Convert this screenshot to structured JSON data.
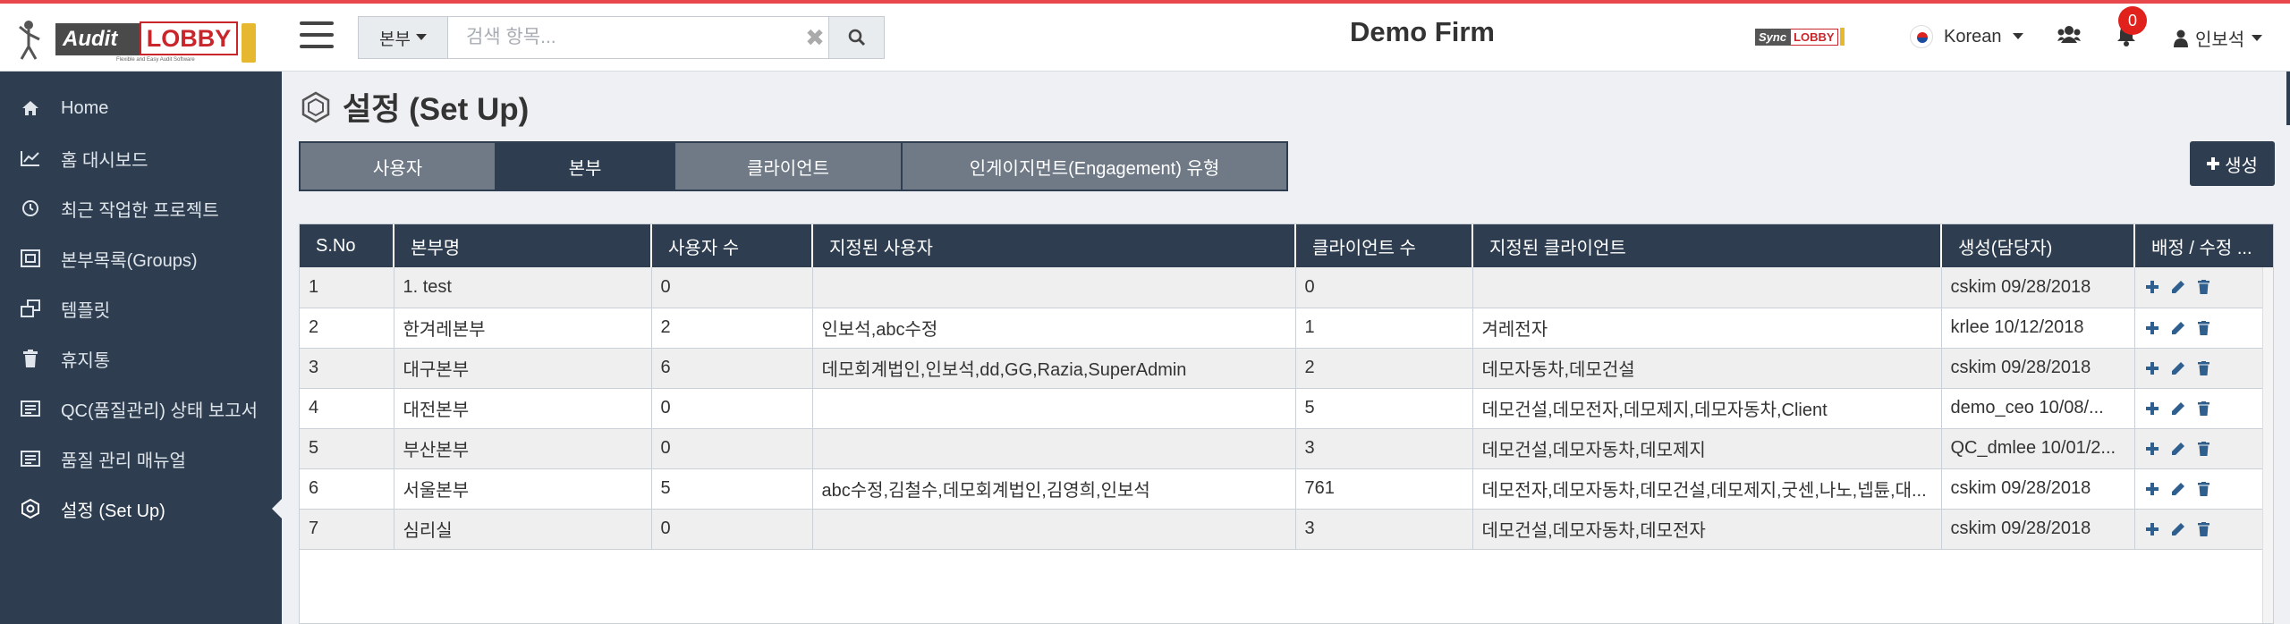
{
  "header": {
    "logo_audit": "Audit",
    "logo_lobby": "LOBBY",
    "logo_tagline": "Flexible and Easy Audit Software",
    "search_scope": "본부",
    "search_placeholder": "검색 항목...",
    "firm_name": "Demo Firm",
    "sync_logo_sync": "Sync",
    "sync_logo_lobby": "LOBBY",
    "language": "Korean",
    "notification_count": "0",
    "user_name": "인보석",
    "accent_color": "#e8474c"
  },
  "sidebar": {
    "items": [
      {
        "label": "Home",
        "icon": "home-icon"
      },
      {
        "label": "홈 대시보드",
        "icon": "chart-line-icon"
      },
      {
        "label": "최근 작업한 프로젝트",
        "icon": "clock-icon"
      },
      {
        "label": "본부목록(Groups)",
        "icon": "groups-icon"
      },
      {
        "label": "템플릿",
        "icon": "template-icon"
      },
      {
        "label": "휴지통",
        "icon": "trash-icon"
      },
      {
        "label": "QC(품질관리) 상태 보고서",
        "icon": "report-icon"
      },
      {
        "label": "품질 관리 매뉴얼",
        "icon": "manual-icon"
      },
      {
        "label": "설정 (Set Up)",
        "icon": "setup-icon"
      }
    ],
    "active_index": 8,
    "bg_color": "#2e3e50"
  },
  "page": {
    "title": "설정 (Set Up)",
    "tabs": [
      {
        "label": "사용자"
      },
      {
        "label": "본부"
      },
      {
        "label": "클라이언트"
      },
      {
        "label": "인게이지먼트(Engagement) 유형"
      }
    ],
    "active_tab": 1,
    "create_label": "생성"
  },
  "table": {
    "headers": [
      "S.No",
      "본부명",
      "사용자 수",
      "지정된 사용자",
      "클라이언트 수",
      "지정된 클라이언트",
      "생성(담당자)",
      "배정 / 수정 ..."
    ],
    "rows": [
      [
        "1",
        "1. test",
        "0",
        "",
        "0",
        "",
        "cskim 09/28/2018"
      ],
      [
        "2",
        "한겨레본부",
        "2",
        "인보석,abc수정",
        "1",
        "겨레전자",
        "krlee 10/12/2018"
      ],
      [
        "3",
        "대구본부",
        "6",
        "데모회계법인,인보석,dd,GG,Razia,SuperAdmin",
        "2",
        "데모자동차,데모건설",
        "cskim 09/28/2018"
      ],
      [
        "4",
        "대전본부",
        "0",
        "",
        "5",
        "데모건설,데모전자,데모제지,데모자동차,Client",
        "demo_ceo 10/08/..."
      ],
      [
        "5",
        "부산본부",
        "0",
        "",
        "3",
        "데모건설,데모자동차,데모제지",
        "QC_dmlee 10/01/2..."
      ],
      [
        "6",
        "서울본부",
        "5",
        "abc수정,김철수,데모회계법인,김영희,인보석",
        "761",
        "데모전자,데모자동차,데모건설,데모제지,굿센,나노,넵튠,대...",
        "cskim 09/28/2018"
      ],
      [
        "7",
        "심리실",
        "0",
        "",
        "3",
        "데모건설,데모자동차,데모전자",
        "cskim 09/28/2018"
      ]
    ]
  }
}
